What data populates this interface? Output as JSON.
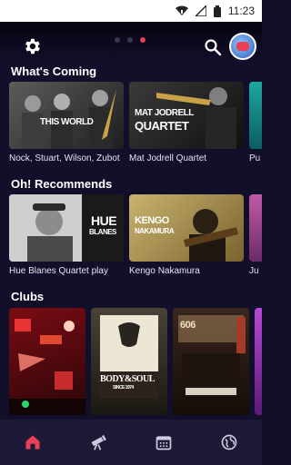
{
  "status_bar": {
    "time": "11:23"
  },
  "header": {
    "icons": [
      "gear-icon",
      "search-icon",
      "profile-avatar"
    ],
    "page_indicator": {
      "count": 3,
      "active": 3
    }
  },
  "sections": {
    "whats_coming": {
      "title": "What's Coming",
      "items": [
        {
          "caption": "Nock, Stuart, Wilson, Zubot",
          "art_text": "THIS WORLD"
        },
        {
          "caption": "Mat Jodrell Quartet",
          "art_text_1": "MAT JODRELL",
          "art_text_2": "QUARTET"
        },
        {
          "caption": "Pu"
        }
      ]
    },
    "oh_recommends": {
      "title": "Oh! Recommends",
      "items": [
        {
          "caption": "Hue Blanes Quartet play",
          "art_text_1": "HUE",
          "art_text_2": "BLANES"
        },
        {
          "caption": "Kengo Nakamura",
          "art_text_1": "KENGO",
          "art_text_2": "NAKAMURA"
        },
        {
          "caption": "Ju"
        }
      ]
    },
    "clubs": {
      "title": "Clubs",
      "items": [
        {
          "name": "club-red-lights"
        },
        {
          "name": "club-body-and-soul",
          "art_text_1": "BODY&SOUL",
          "art_text_2": "SINCE 1974"
        },
        {
          "name": "club-606",
          "art_text": "606"
        },
        {
          "name": "club-purple"
        }
      ]
    }
  },
  "bottom_nav": {
    "items": [
      "home-icon",
      "telescope-icon",
      "calendar-icon",
      "globe-icon"
    ],
    "active": "home-icon"
  },
  "colors": {
    "background": "#120f2a",
    "accent": "#e94057",
    "nav_background": "#1c1a36"
  }
}
